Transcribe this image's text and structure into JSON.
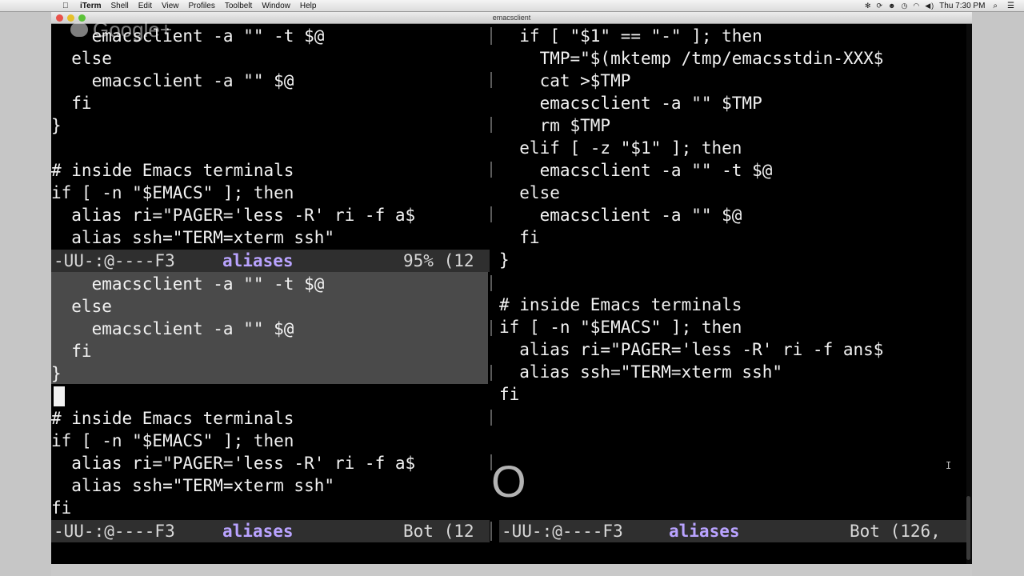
{
  "menubar": {
    "apple": "",
    "items": [
      "iTerm",
      "Shell",
      "Edit",
      "View",
      "Profiles",
      "Toolbelt",
      "Window",
      "Help"
    ],
    "tray_icons": [
      "gear-icon",
      "sync-icon",
      "people-icon",
      "timemachine-icon",
      "wifi-icon",
      "volume-icon"
    ],
    "clock": "Thu 7:30 PM",
    "spotlight_icon": "list-icon"
  },
  "window": {
    "title": "emacsclient"
  },
  "left_pane": {
    "top_lines": "    emacsclient -a \"\" -t $@\n  else\n    emacsclient -a \"\" $@\n  fi\n}\n\n# inside Emacs terminals\nif [ -n \"$EMACS\" ]; then\n  alias ri=\"PAGER='less -R' ri -f a$\n  alias ssh=\"TERM=xterm ssh\"",
    "modeline_top": {
      "status": "-UU-:@----F3  ",
      "buffer": "aliases",
      "position": "95% (12"
    },
    "bottom_lines": "    emacsclient -a \"\" -t $@\n  else\n    emacsclient -a \"\" $@\n  fi\n}\n\n# inside Emacs terminals\nif [ -n \"$EMACS\" ]; then\n  alias ri=\"PAGER='less -R' ri -f a$\n  alias ssh=\"TERM=xterm ssh\"\nfi",
    "modeline_bottom": {
      "status": "-UU-:@----F3  ",
      "buffer": "aliases",
      "position": "Bot (12"
    }
  },
  "right_pane": {
    "lines": "  if [ \"$1\" == \"-\" ]; then\n    TMP=\"$(mktemp /tmp/emacsstdin-XXX$\n    cat >$TMP\n    emacsclient -a \"\" $TMP\n    rm $TMP\n  elif [ -z \"$1\" ]; then\n    emacsclient -a \"\" -t $@\n  else\n    emacsclient -a \"\" $@\n  fi\n}\n\n# inside Emacs terminals\nif [ -n \"$EMACS\" ]; then\n  alias ri=\"PAGER='less -R' ri -f ans$\n  alias ssh=\"TERM=xterm ssh\"\nfi",
    "modeline": {
      "status": "-UU-:@----F3  ",
      "buffer": "aliases",
      "position": "Bot (126,"
    }
  },
  "overlays": {
    "hangout_logo": "Google+",
    "badge_letter": "O",
    "mouse_cursor_icon": "ibeam-cursor-icon"
  }
}
